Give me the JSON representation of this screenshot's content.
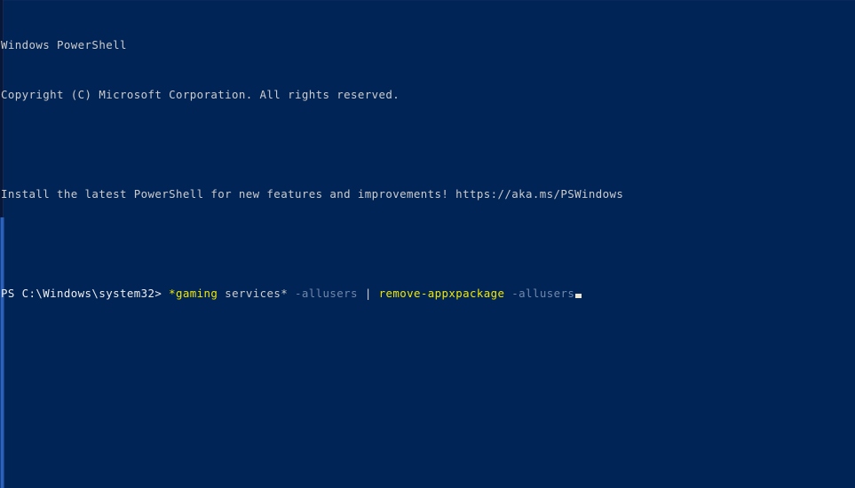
{
  "window": {
    "title": "Windows PowerShell",
    "background_color": "#012456",
    "foreground_color": "#cccccc"
  },
  "console": {
    "banner": {
      "product_line": "Windows PowerShell",
      "copyright_line": "Copyright (C) Microsoft Corporation. All rights reserved.",
      "blank_line_1": " ",
      "upgrade_line": "Install the latest PowerShell for new features and improvements! https://aka.ms/PSWindows",
      "blank_line_2": " "
    },
    "prompt": {
      "text": "PS C:\\Windows\\system32>",
      "color": "#eeeeee"
    },
    "command": {
      "full_text": "*gaming services* -allusers | remove-appxpackage -allusers",
      "tokens": [
        {
          "text": "*gaming",
          "role": "command-name",
          "color": "#f0e800"
        },
        {
          "text": " services*",
          "role": "command-name-tail",
          "color": "#cccccc"
        },
        {
          "text": " -allusers",
          "role": "parameter",
          "color": "#6f87ab"
        },
        {
          "text": " |",
          "role": "pipe-operator",
          "color": "#d8d8d8"
        },
        {
          "text": " remove-appxpackage",
          "role": "command-name",
          "color": "#f0e800"
        },
        {
          "text": " -allusers",
          "role": "parameter",
          "color": "#6f87ab"
        }
      ]
    },
    "cursor": {
      "shape": "underscore-block",
      "color": "#e8e4cf"
    }
  },
  "scrollbar": {
    "name": "vertical-scrollbar",
    "orientation": "vertical",
    "edge": "left",
    "track_color": "#07173a",
    "thumb_color": "#1d52a8"
  }
}
